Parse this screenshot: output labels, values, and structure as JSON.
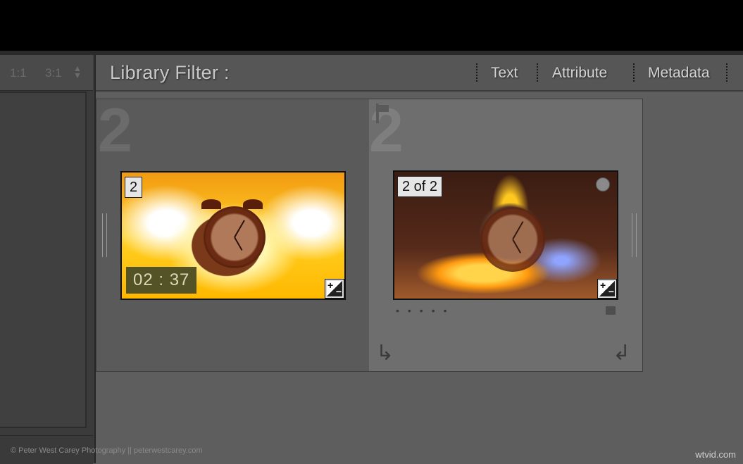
{
  "left_panel": {
    "zoom_options": [
      "1:1",
      "3:1"
    ]
  },
  "filter_bar": {
    "title": "Library Filter :",
    "options": [
      "Text",
      "Attribute",
      "Metadata"
    ]
  },
  "grid": {
    "cells": [
      {
        "index_number": "2",
        "badge": "2",
        "duration": "02 : 37"
      },
      {
        "index_number": "2",
        "badge": "2 of 2"
      }
    ]
  },
  "footer": {
    "credit": "© Peter West Carey Photography || peterwestcarey.com",
    "watermark": "wtvid.com"
  },
  "colors": {
    "background": "#5e5e5e",
    "topbar": "#000000",
    "timer_bg": "#545326"
  },
  "icons": [
    "updown-arrows-icon",
    "flag-icon",
    "adjustment-icon",
    "rotate-left-icon",
    "rotate-right-icon"
  ]
}
